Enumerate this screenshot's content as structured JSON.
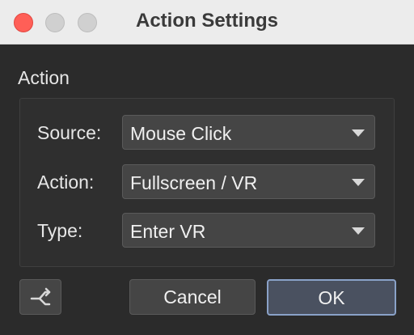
{
  "window": {
    "title": "Action Settings"
  },
  "section": {
    "label": "Action"
  },
  "fields": [
    {
      "label": "Source:",
      "value": "Mouse Click"
    },
    {
      "label": "Action:",
      "value": "Fullscreen / VR"
    },
    {
      "label": "Type:",
      "value": "Enter VR"
    }
  ],
  "buttons": {
    "icon": "branch-arrow-icon",
    "cancel": "Cancel",
    "ok": "OK"
  },
  "colors": {
    "close": "#ff5f57",
    "background": "#2b2b2b",
    "accent_border": "#8aa2c8"
  }
}
